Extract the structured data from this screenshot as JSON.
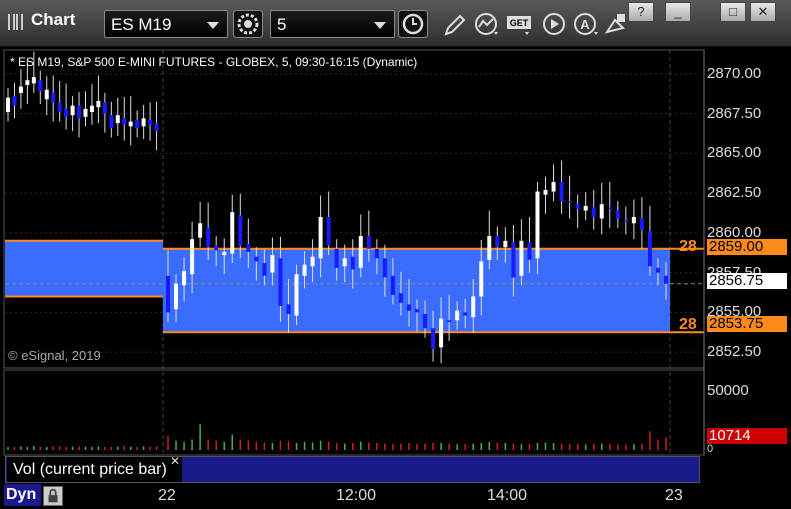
{
  "app": {
    "title": "Chart"
  },
  "toolbar": {
    "symbol": "ES M19",
    "interval": "5",
    "icons": [
      "refresh-gear-icon",
      "clock-icon",
      "pencil-icon",
      "study-icon",
      "get-icon",
      "play-icon",
      "alert-icon",
      "draw-tool-icon"
    ]
  },
  "window_buttons": {
    "help": "?",
    "minimize": "_",
    "maximize": "□",
    "close": "✕"
  },
  "chart": {
    "header": "* ES M19, S&P 500 E-MINI FUTURES - GLOBEX, 5, 09:30-16:15 (Dynamic)",
    "copyright": "© eSignal, 2019",
    "price_ticks": [
      "2870.00",
      "2867.50",
      "2865.00",
      "2862.50",
      "2860.00",
      "2857.50",
      "2855.00",
      "2852.50"
    ],
    "badges": {
      "upper": {
        "label": "2859.00",
        "tag": "28",
        "color": "#ff8a1c"
      },
      "last": {
        "label": "2856.75",
        "color": "#ffffff"
      },
      "lower": {
        "label": "2853.75",
        "tag": "28",
        "color": "#ff8a1c"
      }
    },
    "volume_ticks": [
      "50000",
      "0"
    ],
    "volume_badge": {
      "label": "10714",
      "color": "#cc0000"
    },
    "x_ticks": [
      "22",
      "12:00",
      "14:00",
      "23"
    ],
    "volume_panel_label": "Vol (current price bar)",
    "status": "Dyn"
  },
  "chart_data": {
    "type": "candlestick",
    "ylim": [
      2851.5,
      2871.5
    ],
    "zones": [
      {
        "from": 2859.5,
        "to": 2856.0,
        "color": "#3a6cff"
      },
      {
        "from": 2859.0,
        "to": 2853.75,
        "color": "#3a6cff"
      }
    ],
    "closes": [
      2868.5,
      2868.0,
      2869.2,
      2869.6,
      2869.8,
      2868.9,
      2869.0,
      2868.2,
      2867.6,
      2867.3,
      2868.0,
      2867.2,
      2867.8,
      2868.0,
      2868.3,
      2867.5,
      2866.6,
      2867.4,
      2866.8,
      2867.0,
      2866.6,
      2867.2,
      2866.8,
      2866.4,
      2855.0,
      2856.8,
      2857.6,
      2859.6,
      2860.6,
      2859.1,
      2858.9,
      2858.8,
      2861.3,
      2859.2,
      2858.8,
      2858.2,
      2857.3,
      2858.6,
      2855.4,
      2854.9,
      2857.4,
      2858.0,
      2858.5,
      2861.0,
      2859.2,
      2857.8,
      2858.4,
      2857.7,
      2859.8,
      2859.0,
      2858.4,
      2857.2,
      2856.1,
      2855.6,
      2855.1,
      2855.0,
      2854.0,
      2852.7,
      2854.6,
      2854.4,
      2855.1,
      2854.8,
      2856.0,
      2858.2,
      2859.8,
      2859.1,
      2859.5,
      2857.2,
      2859.5,
      2858.3,
      2862.6,
      2862.7,
      2863.2,
      2862.0,
      2861.9,
      2861.5,
      2861.7,
      2861.0,
      2861.8,
      2861.5,
      2860.9,
      2860.7,
      2861.0,
      2860.2,
      2857.9,
      2857.5,
      2856.8
    ],
    "opens": [
      2867.6,
      2868.6,
      2868.8,
      2869.3,
      2869.4,
      2869.6,
      2868.4,
      2868.8,
      2868.2,
      2867.8,
      2867.4,
      2868.0,
      2867.3,
      2867.6,
      2867.9,
      2868.2,
      2867.4,
      2866.9,
      2867.2,
      2866.7,
      2867.1,
      2866.7,
      2867.1,
      2866.9,
      2857.3,
      2855.2,
      2856.7,
      2857.4,
      2859.7,
      2860.3,
      2859.2,
      2858.6,
      2858.7,
      2861.1,
      2859.3,
      2858.5,
      2858.1,
      2857.5,
      2858.4,
      2855.5,
      2854.8,
      2857.3,
      2857.9,
      2858.4,
      2861.0,
      2859.0,
      2857.9,
      2858.5,
      2857.8,
      2859.8,
      2859.0,
      2858.4,
      2857.3,
      2856.2,
      2855.5,
      2855.2,
      2854.9,
      2854.0,
      2852.8,
      2854.5,
      2854.5,
      2855.0,
      2854.7,
      2856.0,
      2858.3,
      2859.8,
      2859.1,
      2859.4,
      2857.3,
      2859.4,
      2858.4,
      2862.4,
      2862.6,
      2863.2,
      2862.0,
      2861.8,
      2861.4,
      2861.6,
      2860.9,
      2861.6,
      2861.4,
      2860.8,
      2860.6,
      2860.9,
      2860.1,
      2857.8,
      2857.3
    ],
    "volumes": [
      2500,
      2800,
      3100,
      2600,
      3500,
      2900,
      2700,
      3000,
      3300,
      2600,
      2800,
      3200,
      2900,
      2700,
      3100,
      2800,
      2600,
      3000,
      3400,
      2900,
      2700,
      3100,
      2800,
      3000,
      12000,
      8000,
      7000,
      9000,
      22000,
      9000,
      8000,
      7000,
      13000,
      9000,
      8000,
      7000,
      6500,
      6000,
      8000,
      7500,
      6000,
      7000,
      6500,
      8000,
      7000,
      6000,
      5500,
      6000,
      7000,
      6500,
      6000,
      5500,
      5000,
      5500,
      6000,
      5000,
      5500,
      6500,
      6000,
      5500,
      5000,
      5000,
      5500,
      6000,
      7000,
      6500,
      6000,
      5500,
      5000,
      5500,
      6000,
      6500,
      6000,
      5500,
      5000,
      5200,
      4800,
      5000,
      5500,
      5000,
      4800,
      4600,
      5000,
      5200,
      16000,
      9000,
      10714
    ],
    "x_ticks": [
      "22",
      "12:00",
      "14:00",
      "23"
    ]
  }
}
